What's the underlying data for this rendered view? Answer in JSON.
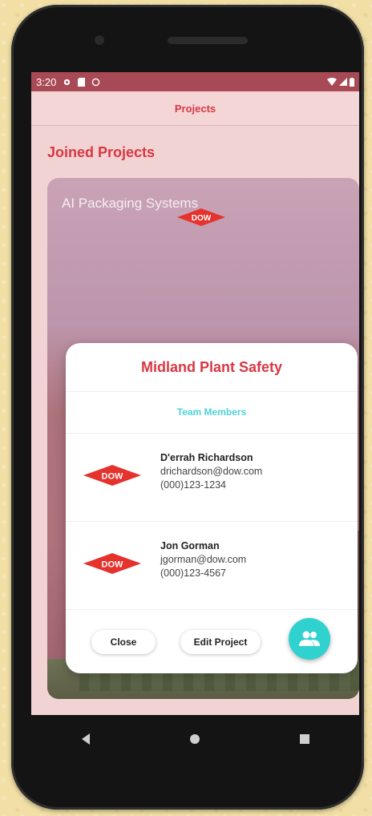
{
  "status": {
    "time": "3:20"
  },
  "appbar": {
    "title": "Projects"
  },
  "section": {
    "title": "Joined Projects"
  },
  "card": {
    "title": "AI Packaging Systems",
    "logo_text": "DOW"
  },
  "dialog": {
    "title": "Midland Plant Safety",
    "subtitle": "Team Members",
    "members": [
      {
        "name": "D'errah Richardson",
        "email": "drichardson@dow.com",
        "phone": "(000)123-1234",
        "logo_text": "DOW"
      },
      {
        "name": "Jon Gorman",
        "email": "jgorman@dow.com",
        "phone": "(000)123-4567",
        "logo_text": "DOW"
      }
    ],
    "close_label": "Close",
    "edit_label": "Edit Project",
    "fab_icon": "group-icon"
  },
  "colors": {
    "accent": "#d93743",
    "teal": "#2fd2cf",
    "subtitle": "#4fd1d9"
  }
}
